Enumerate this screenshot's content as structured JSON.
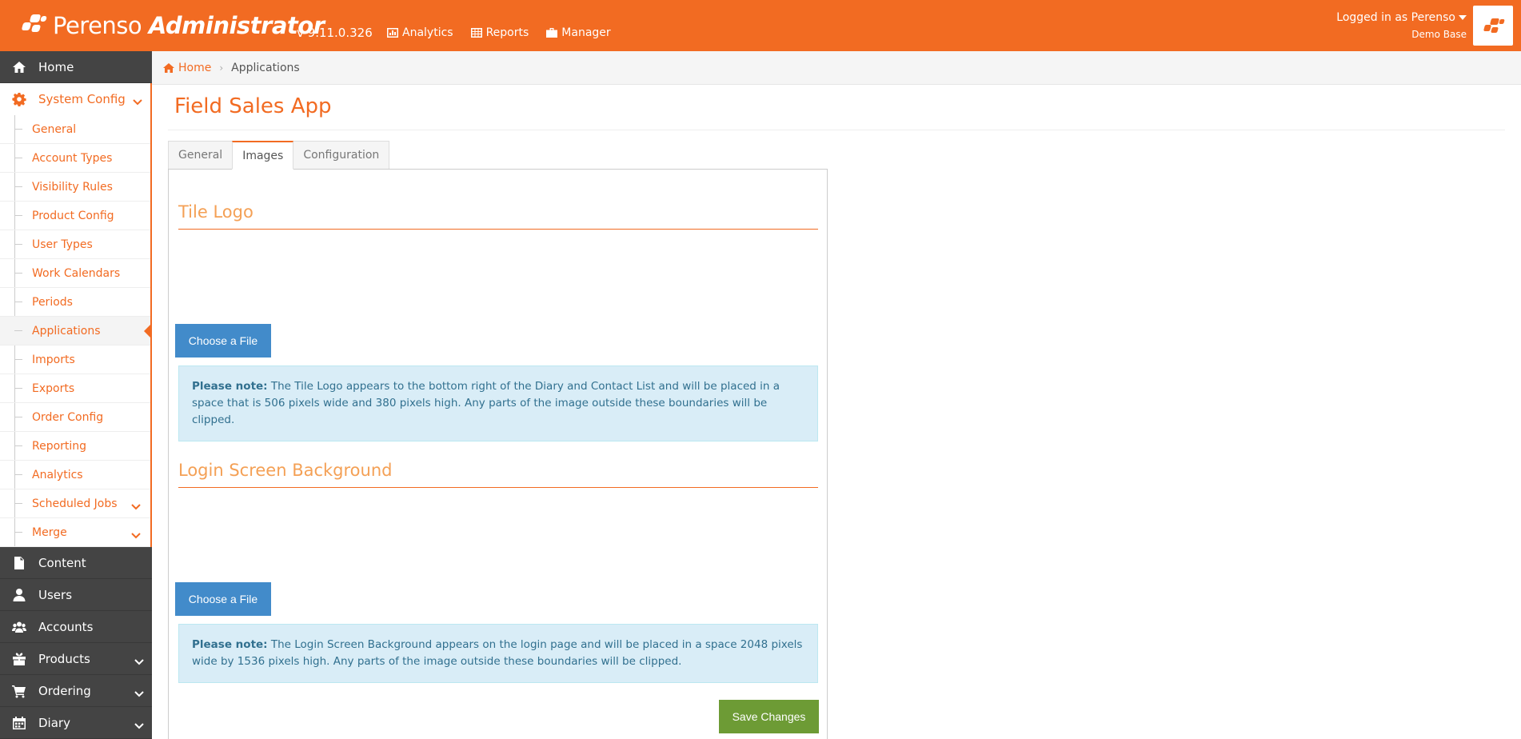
{
  "header": {
    "brand_light": "Perenso",
    "brand_bold": "Administrator",
    "version": "v 9.11.0.326",
    "nav": [
      {
        "label": "Analytics",
        "icon": "chart-icon"
      },
      {
        "label": "Reports",
        "icon": "table-icon"
      },
      {
        "label": "Manager",
        "icon": "briefcase-icon"
      }
    ],
    "user_line": "Logged in as Perenso",
    "user_sub": "Demo Base",
    "accent": "#f26b22"
  },
  "sidebar": {
    "home": "Home",
    "system_config": "System Config",
    "sub_items": [
      "General",
      "Account Types",
      "Visibility Rules",
      "Product Config",
      "User Types",
      "Work Calendars",
      "Periods",
      "Applications",
      "Imports",
      "Exports",
      "Order Config",
      "Reporting",
      "Analytics",
      "Scheduled Jobs",
      "Merge"
    ],
    "current_sub": "Applications",
    "content": "Content",
    "users": "Users",
    "accounts": "Accounts",
    "products": "Products",
    "ordering": "Ordering",
    "diary": "Diary"
  },
  "breadcrumb": {
    "home": "Home",
    "current": "Applications"
  },
  "page": {
    "title": "Field Sales App",
    "tabs": [
      "General",
      "Images",
      "Configuration"
    ],
    "active_tab": "Images"
  },
  "tile_logo": {
    "heading": "Tile Logo",
    "button": "Choose a File",
    "note_label": "Please note:",
    "note_text": " The Tile Logo appears to the bottom right of the Diary and Contact List and will be placed in a space that is 506 pixels wide and 380 pixels high. Any parts of the image outside these boundaries will be clipped."
  },
  "login_bg": {
    "heading": "Login Screen Background",
    "button": "Choose a File",
    "note_label": "Please note:",
    "note_text": " The Login Screen Background appears on the login page and will be placed in a space 2048 pixels wide by 1536 pixels high. Any parts of the image outside these boundaries will be clipped."
  },
  "save_button": "Save Changes"
}
